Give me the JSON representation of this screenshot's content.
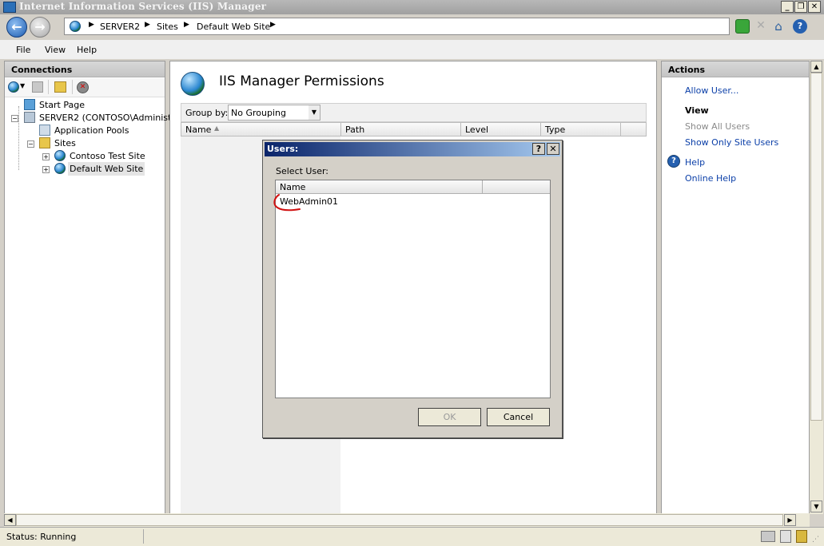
{
  "window": {
    "title": "Internet Information Services (IIS) Manager"
  },
  "address_bar": {
    "crumbs": [
      "SERVER2",
      "Sites",
      "Default Web Site"
    ]
  },
  "menu": [
    "File",
    "View",
    "Help"
  ],
  "connections": {
    "title": "Connections",
    "tree": {
      "start_page": "Start Page",
      "server": "SERVER2 (CONTOSO\\Administra",
      "app_pools": "Application Pools",
      "sites": "Sites",
      "site1": "Contoso Test Site",
      "site2": "Default Web Site"
    }
  },
  "main": {
    "title": "IIS Manager Permissions",
    "group_by_label": "Group by:",
    "group_by_value": "No Grouping",
    "columns": [
      "Name",
      "Path",
      "Level",
      "Type"
    ]
  },
  "actions": {
    "title": "Actions",
    "allow_user": "Allow User...",
    "view_header": "View",
    "show_all_users": "Show All Users",
    "show_only_site_users": "Show Only Site Users",
    "help": "Help",
    "online_help": "Online Help"
  },
  "dialog": {
    "title": "Users:",
    "select_user_label": "Select User:",
    "column_name": "Name",
    "users": [
      "WebAdmin01"
    ],
    "ok": "OK",
    "cancel": "Cancel",
    "help_btn": "?",
    "close_btn": "✕"
  },
  "status": {
    "text": "Status: Running"
  },
  "colors": {
    "link": "#0b3fa8",
    "dialog_title_start": "#0a246a",
    "annotation": "#d01010"
  }
}
